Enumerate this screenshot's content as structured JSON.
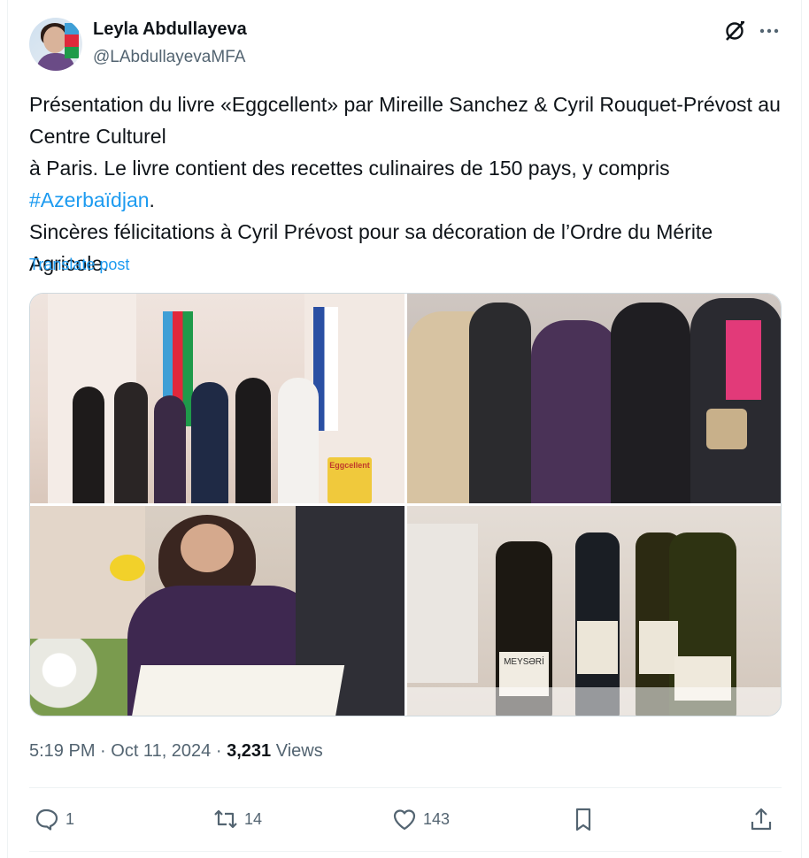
{
  "author": {
    "name": "Leyla Abdullayeva",
    "handle": "@LAbdullayevaMFA"
  },
  "header_icons": {
    "grok": "grok-icon",
    "more": "more-icon"
  },
  "tweet": {
    "text_part1": "Présentation du livre «Eggcellent» par Mireille Sanchez & Cyril Rouquet-Prévost au Centre Culturel",
    "text_part2": " à Paris. Le livre contient des recettes culinaires de 150 pays, y compris ",
    "hashtag": "#Azerbaïdjan",
    "text_part3": ".",
    "text_line2": "Sincères félicitations à Cyril Prévost pour sa décoration de l’Ordre du Mérite Agricole.",
    "translate_label": "Translate post"
  },
  "photos": [
    {
      "book_label": "Eggcellent"
    },
    {},
    {},
    {
      "bottle_label": "MEYSƏRİ"
    }
  ],
  "meta": {
    "time": "5:19 PM",
    "dot1": " · ",
    "date": "Oct 11, 2024",
    "dot2": " · ",
    "views_count": "3,231",
    "views_label": " Views"
  },
  "actions": {
    "replies": "1",
    "reposts": "14",
    "likes": "143"
  },
  "colors": {
    "accent": "#1d9bf0",
    "text": "#0f1419",
    "secondary": "#536471",
    "flag_blue": "#3f9fd6",
    "flag_red": "#e0283b",
    "flag_green": "#1f9a4a"
  }
}
